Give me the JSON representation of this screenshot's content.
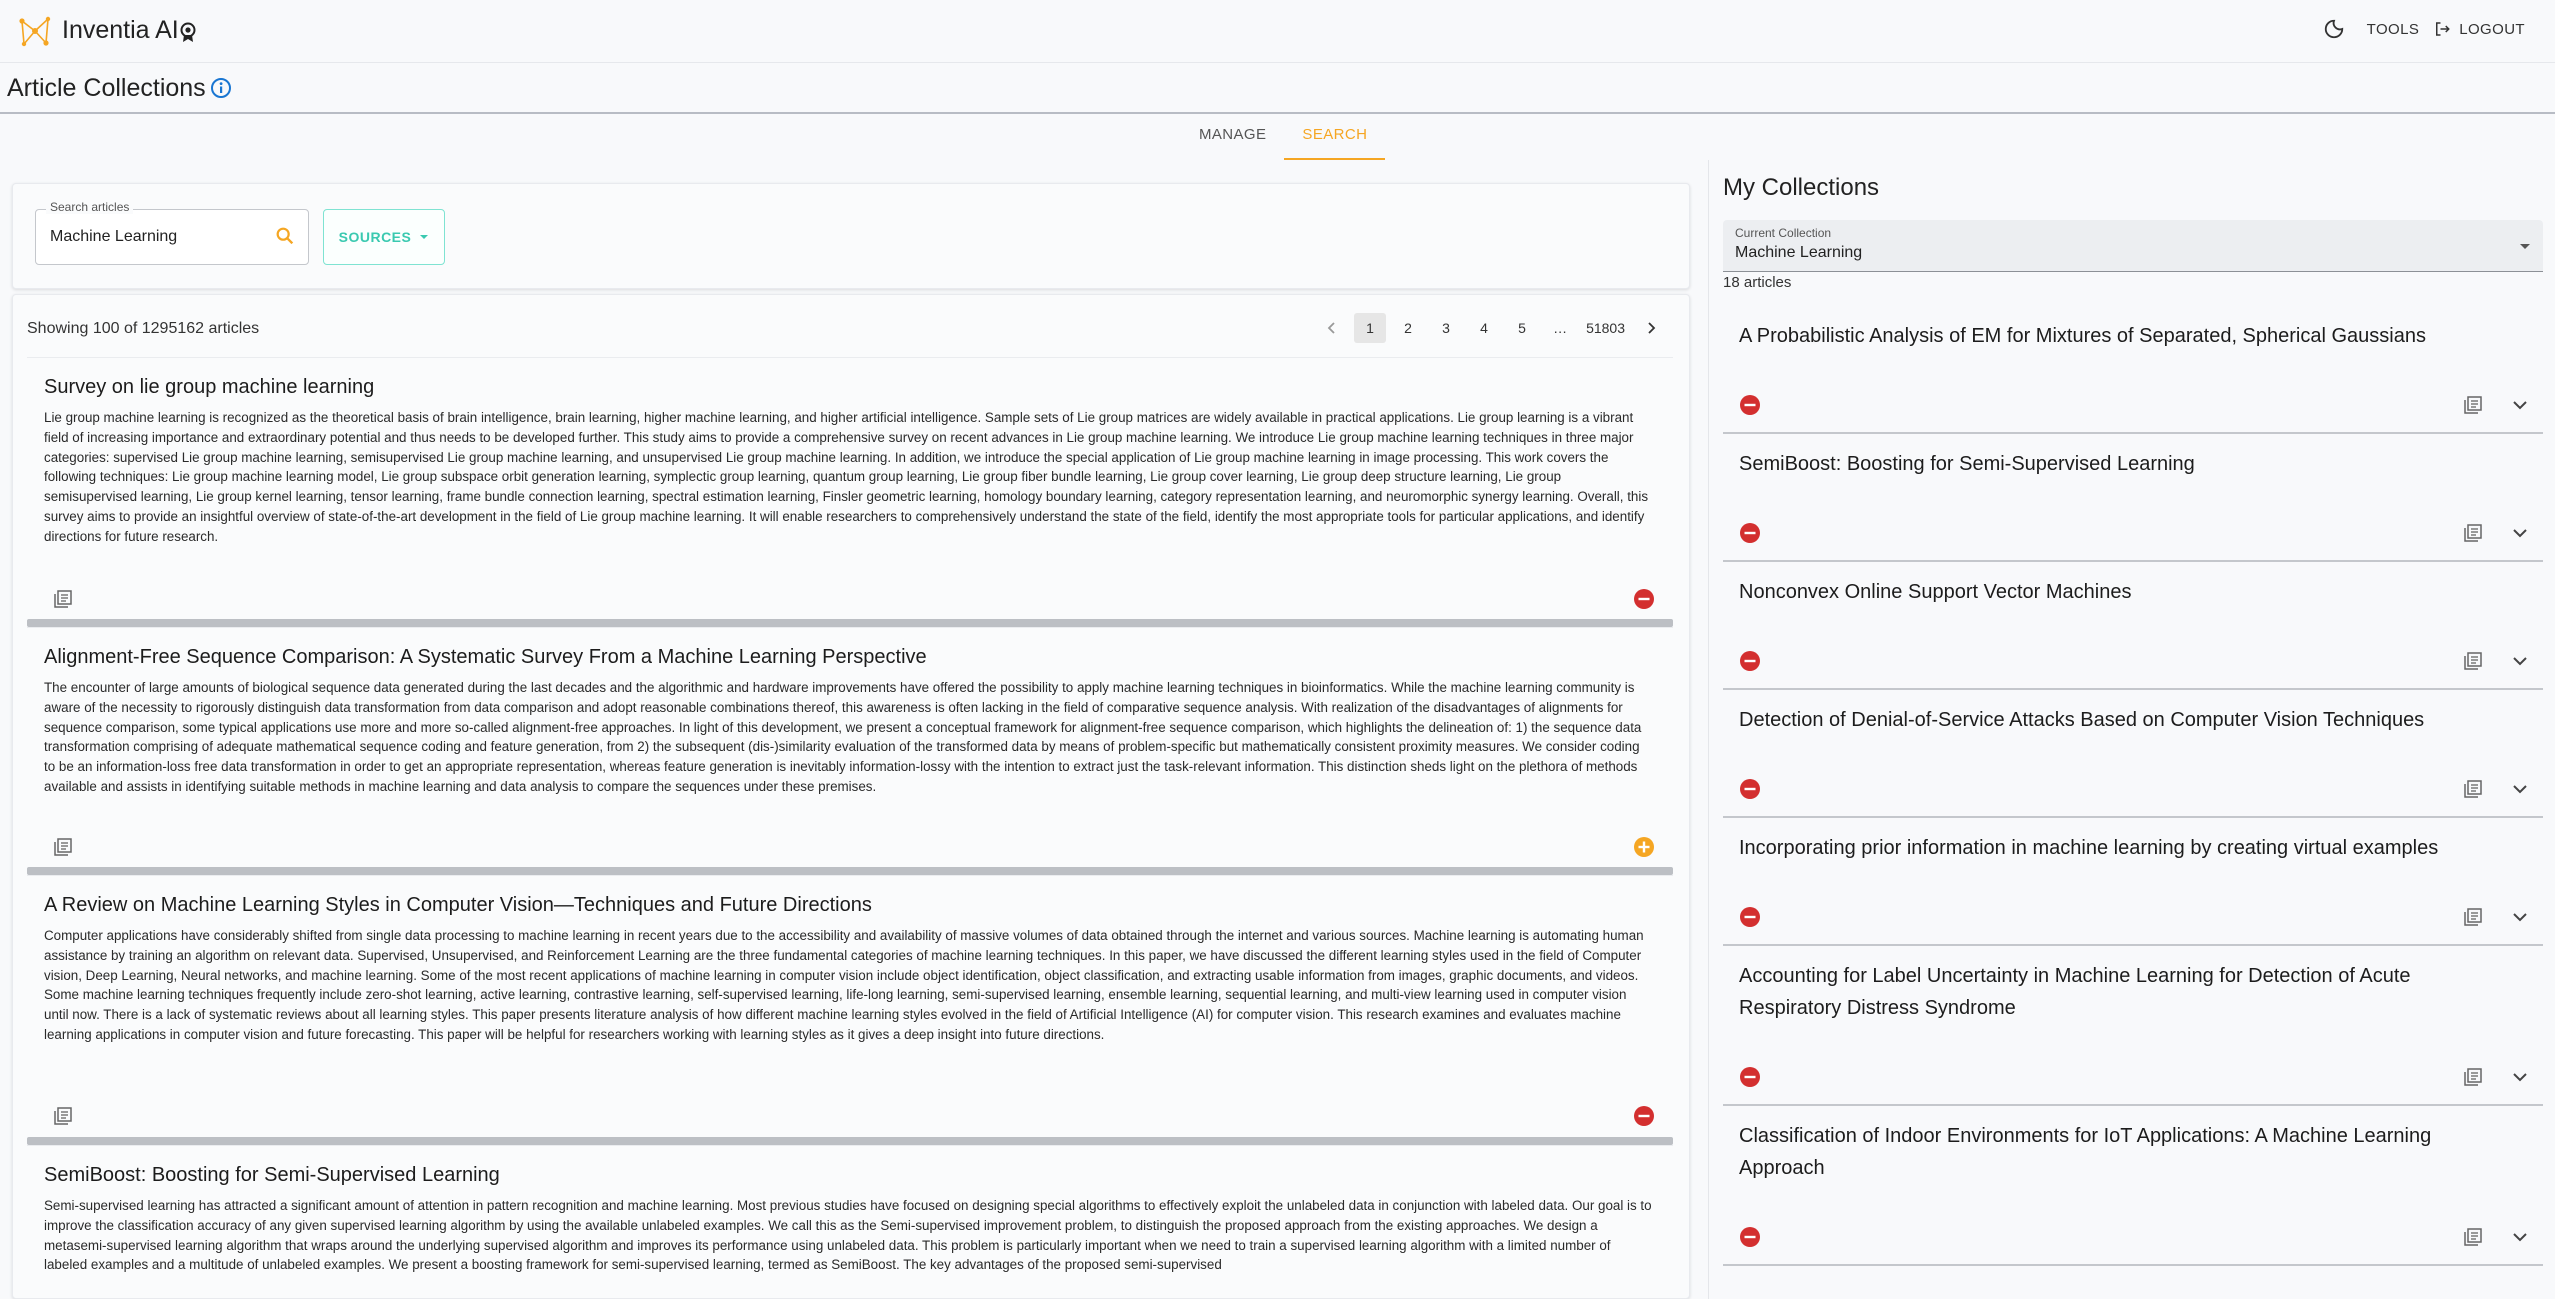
{
  "app": {
    "title": "Inventia AI",
    "accent": "#f5a623",
    "teal": "#3ac9b0"
  },
  "topbar": {
    "theme_icon": "moon-icon",
    "tools_label": "TOOLS",
    "logout_label": "LOGOUT"
  },
  "page": {
    "title": "Article Collections"
  },
  "tabs": [
    {
      "label": "MANAGE",
      "active": false
    },
    {
      "label": "SEARCH",
      "active": true
    }
  ],
  "search": {
    "label": "Search articles",
    "value": "Machine Learning",
    "sources_label": "SOURCES"
  },
  "results": {
    "showing": "Showing 100 of 1295162 articles",
    "pages": [
      "1",
      "2",
      "3",
      "4",
      "5",
      "…",
      "51803"
    ],
    "current_page": "1",
    "articles": [
      {
        "title": "Survey on lie group machine learning",
        "abstract": "Lie group machine learning is recognized as the theoretical basis of brain intelligence, brain learning, higher machine learning, and higher artificial intelligence. Sample sets of Lie group matrices are widely available in practical applications. Lie group learning is a vibrant field of increasing importance and extraordinary potential and thus needs to be developed further. This study aims to provide a comprehensive survey on recent advances in Lie group machine learning. We introduce Lie group machine learning techniques in three major categories: supervised Lie group machine learning, semisupervised Lie group machine learning, and unsupervised Lie group machine learning. In addition, we introduce the special application of Lie group machine learning in image processing. This work covers the following techniques: Lie group machine learning model, Lie group subspace orbit generation learning, symplectic group learning, quantum group learning, Lie group fiber bundle learning, Lie group cover learning, Lie group deep structure learning, Lie group semisupervised learning, Lie group kernel learning, tensor learning, frame bundle connection learning, spectral estimation learning, Finsler geometric learning, homology boundary learning, category representation learning, and neuromorphic synergy learning. Overall, this survey aims to provide an insightful overview of state-of-the-art development in the field of Lie group machine learning. It will enable researchers to comprehensively understand the state of the field, identify the most appropriate tools for particular applications, and identify directions for future research.",
        "action": "remove"
      },
      {
        "title": "Alignment-Free Sequence Comparison: A Systematic Survey From a Machine Learning Perspective",
        "abstract": "The encounter of large amounts of biological sequence data generated during the last decades and the algorithmic and hardware improvements have offered the possibility to apply machine learning techniques in bioinformatics. While the machine learning community is aware of the necessity to rigorously distinguish data transformation from data comparison and adopt reasonable combinations thereof, this awareness is often lacking in the field of comparative sequence analysis. With realization of the disadvantages of alignments for sequence comparison, some typical applications use more and more so-called alignment-free approaches. In light of this development, we present a conceptual framework for alignment-free sequence comparison, which highlights the delineation of: 1) the sequence data transformation comprising of adequate mathematical sequence coding and feature generation, from 2) the subsequent (dis-)similarity evaluation of the transformed data by means of problem-specific but mathematically consistent proximity measures. We consider coding to be an information-loss free data transformation in order to get an appropriate representation, whereas feature generation is inevitably information-lossy with the intention to extract just the task-relevant information. This distinction sheds light on the plethora of methods available and assists in identifying suitable methods in machine learning and data analysis to compare the sequences under these premises.",
        "action": "add"
      },
      {
        "title": "A Review on Machine Learning Styles in Computer Vision—Techniques and Future Directions",
        "abstract": "Computer applications have considerably shifted from single data processing to machine learning in recent years due to the accessibility and availability of massive volumes of data obtained through the internet and various sources. Machine learning is automating human assistance by training an algorithm on relevant data. Supervised, Unsupervised, and Reinforcement Learning are the three fundamental categories of machine learning techniques. In this paper, we have discussed the different learning styles used in the field of Computer vision, Deep Learning, Neural networks, and machine learning. Some of the most recent applications of machine learning in computer vision include object identification, object classification, and extracting usable information from images, graphic documents, and videos. Some machine learning techniques frequently include zero-shot learning, active learning, contrastive learning, self-supervised learning, life-long learning, semi-supervised learning, ensemble learning, sequential learning, and multi-view learning used in computer vision until now. There is a lack of systematic reviews about all learning styles. This paper presents literature analysis of how different machine learning styles evolved in the field of Artificial Intelligence (AI) for computer vision. This research examines and evaluates machine learning applications in computer vision and future forecasting. This paper will be helpful for researchers working with learning styles as it gives a deep insight into future directions.",
        "action": "remove"
      },
      {
        "title": "SemiBoost: Boosting for Semi-Supervised Learning",
        "abstract": "Semi-supervised learning has attracted a significant amount of attention in pattern recognition and machine learning. Most previous studies have focused on designing special algorithms to effectively exploit the unlabeled data in conjunction with labeled data. Our goal is to improve the classification accuracy of any given supervised learning algorithm by using the available unlabeled examples. We call this as the Semi-supervised improvement problem, to distinguish the proposed approach from the existing approaches. We design a metasemi-supervised learning algorithm that wraps around the underlying supervised algorithm and improves its performance using unlabeled data. This problem is particularly important when we need to train a supervised learning algorithm with a limited number of labeled examples and a multitude of unlabeled examples. We present a boosting framework for semi-supervised learning, termed as SemiBoost. The key advantages of the proposed semi-supervised",
        "action": "remove"
      }
    ]
  },
  "collections": {
    "title": "My Collections",
    "current_label": "Current Collection",
    "current_value": "Machine Learning",
    "count": "18 articles",
    "items": [
      {
        "title": "A Probabilistic Analysis of EM for Mixtures of Separated, Spherical Gaussians"
      },
      {
        "title": "SemiBoost: Boosting for Semi-Supervised Learning"
      },
      {
        "title": "Nonconvex Online Support Vector Machines"
      },
      {
        "title": "Detection of Denial-of-Service Attacks Based on Computer Vision Techniques"
      },
      {
        "title": "Incorporating prior information in machine learning by creating virtual examples"
      },
      {
        "title": "Accounting for Label Uncertainty in Machine Learning for Detection of Acute Respiratory Distress Syndrome"
      },
      {
        "title": "Classification of Indoor Environments for IoT Applications: A Machine Learning Approach"
      }
    ]
  }
}
